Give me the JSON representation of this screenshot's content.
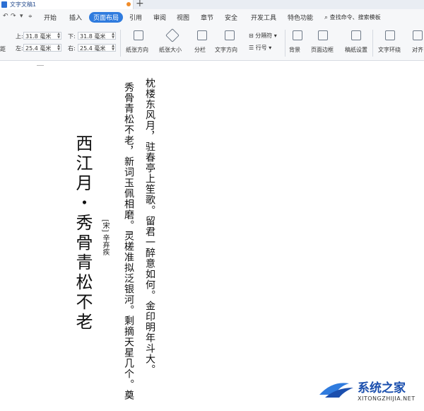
{
  "window": {
    "document_tab_title": "文字文稿1",
    "new_tab_symbol": "+"
  },
  "tabs": {
    "items": [
      "开始",
      "插入",
      "页面布局",
      "引用",
      "审阅",
      "视图",
      "章节",
      "安全",
      "开发工具",
      "特色功能"
    ],
    "active": "页面布局",
    "search_label": "查找命令、搜索模板"
  },
  "ribbon": {
    "margins": {
      "top_label": "上:",
      "top_value": "31.8 毫米",
      "bottom_label": "下:",
      "bottom_value": "31.8 毫米",
      "left_label": "左:",
      "left_value": "25.4 毫米",
      "right_label": "右:",
      "right_value": "25.4 毫米",
      "left_edge_label": "距"
    },
    "buttons": {
      "orientation": "纸张方向",
      "size": "纸张大小",
      "columns": "分栏",
      "text_direction": "文字方向",
      "separator": "分隔符",
      "line_numbers": "行号",
      "background": "背景",
      "page_border": "页面边框",
      "page_setup": "稿纸设置",
      "text_wrap": "文字环绕",
      "align": "对齐"
    }
  },
  "document": {
    "title": "西江月・秀骨青松不老",
    "author": "[宋] 辛弃疾",
    "lines": [
      "秀骨青松不老，新词玉佩相磨。灵槎准拟泛银河。剩摘天星几个。奠",
      "枕楼东风月，驻春亭上笙歌。留君一醉意如何。金印明年斗大。"
    ]
  },
  "watermark": {
    "name": "系统之家",
    "url": "XITONGZHIJIA.NET"
  },
  "colors": {
    "accent": "#2f7bde",
    "tab_dot": "#f08c2a",
    "watermark": "#1b4fae"
  }
}
